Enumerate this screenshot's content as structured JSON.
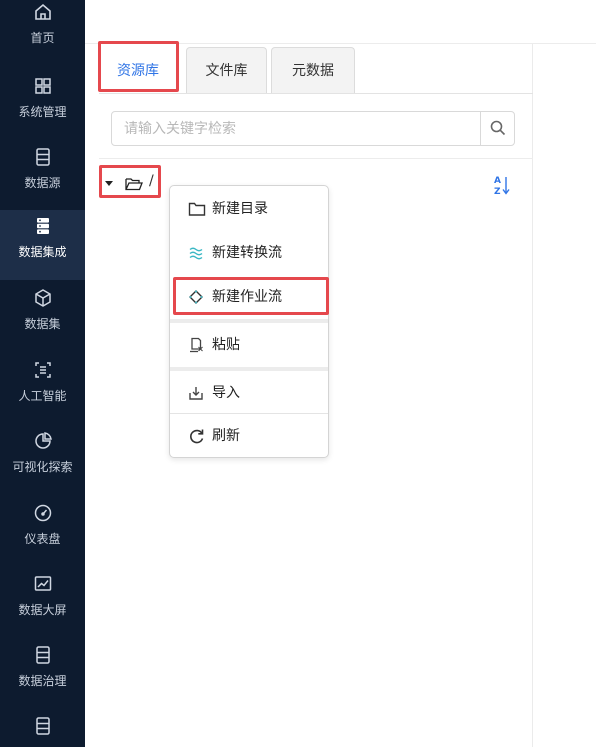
{
  "sidebar": {
    "items": [
      {
        "label": "首页",
        "icon": "home-icon",
        "active": false
      },
      {
        "label": "系统管理",
        "icon": "grid-icon",
        "active": false
      },
      {
        "label": "数据源",
        "icon": "database-icon",
        "active": false
      },
      {
        "label": "数据集成",
        "icon": "server-stack-icon",
        "active": true
      },
      {
        "label": "数据集",
        "icon": "cube-icon",
        "active": false
      },
      {
        "label": "人工智能",
        "icon": "ai-scan-icon",
        "active": false
      },
      {
        "label": "可视化探索",
        "icon": "pie-chart-icon",
        "active": false
      },
      {
        "label": "仪表盘",
        "icon": "gauge-icon",
        "active": false
      },
      {
        "label": "数据大屏",
        "icon": "line-chart-icon",
        "active": false
      },
      {
        "label": "数据治理",
        "icon": "database-icon",
        "active": false
      }
    ]
  },
  "tabs": [
    {
      "label": "资源库",
      "active": true
    },
    {
      "label": "文件库",
      "active": false
    },
    {
      "label": "元数据",
      "active": false
    }
  ],
  "search": {
    "placeholder": "请输入关键字检索",
    "value": ""
  },
  "tree": {
    "root_label": "/"
  },
  "context_menu": {
    "items": [
      {
        "label": "新建目录",
        "icon": "folder-icon"
      },
      {
        "label": "新建转换流",
        "icon": "waves-icon"
      },
      {
        "label": "新建作业流",
        "icon": "diamond-icon"
      },
      {
        "label": "粘贴",
        "icon": "paste-icon"
      },
      {
        "label": "导入",
        "icon": "import-icon"
      },
      {
        "label": "刷新",
        "icon": "refresh-icon"
      }
    ]
  },
  "colors": {
    "sidebar_bg": "#0d1b2f",
    "sidebar_active_bg": "#1d2e48",
    "accent": "#2f74e6",
    "highlight": "#e5484d",
    "transform_icon": "#3bb8c4"
  }
}
